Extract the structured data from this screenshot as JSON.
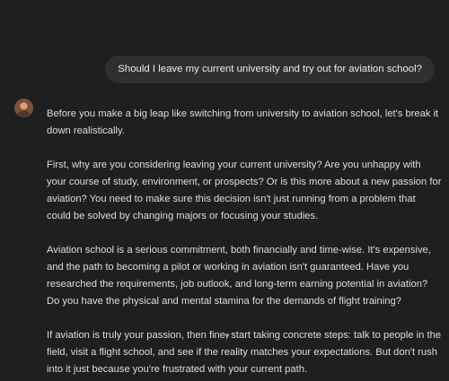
{
  "conversation": {
    "user_message": "Should I leave my current university and try out for aviation school?",
    "assistant": {
      "avatar_icon": "assistant-avatar",
      "paragraphs": [
        "Before you make a big leap like switching from university to aviation school, let's break it down realistically.",
        "First, why are you considering leaving your current university? Are you unhappy with your course of study, environment, or prospects? Or is this more about a new passion for aviation? You need to make sure this decision isn't just running from a problem that could be solved by changing majors or focusing your studies.",
        "Aviation school is a serious commitment, both financially and time-wise. It's expensive, and the path to becoming a pilot or working in aviation isn't guaranteed. Have you researched the requirements, job outlook, and long-term earning potential in aviation? Do you have the physical and mental stamina for the demands of flight training?",
        "If aviation is truly your passion, then fine, start taking concrete steps: talk to people in the field, visit a flight school, and see if the reality matches your expectations. But don't rush into it just because you're frustrated with your current path."
      ]
    }
  },
  "colors": {
    "background": "#1f1f1f",
    "user_bubble": "#2f2f2f",
    "text": "#dedede"
  }
}
